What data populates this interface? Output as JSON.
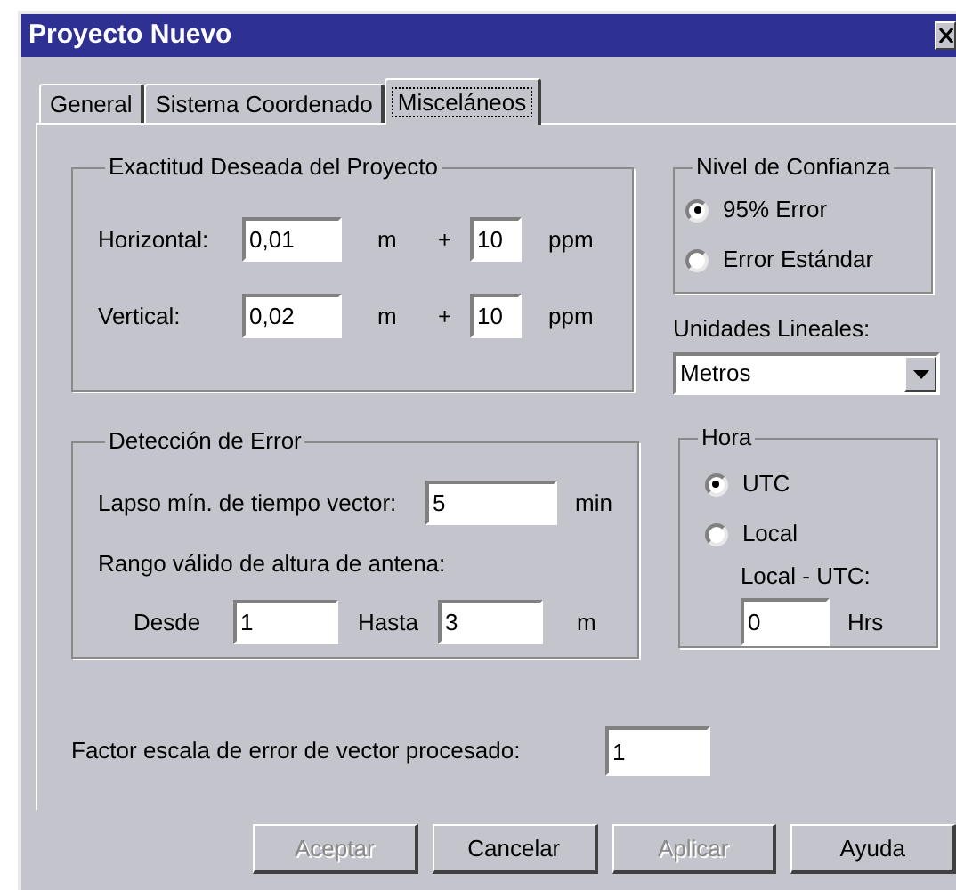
{
  "window": {
    "title": "Proyecto Nuevo"
  },
  "tabs": [
    {
      "label": "General",
      "selected": false
    },
    {
      "label": "Sistema Coordenado",
      "selected": false
    },
    {
      "label": "Misceláneos",
      "selected": true
    }
  ],
  "accuracy": {
    "title": "Exactitud Deseada del Proyecto",
    "rows": [
      {
        "label": "Horizontal:",
        "value": "0,01",
        "unit": "m",
        "plus": "+",
        "ppm_value": "10",
        "ppm_unit": "ppm"
      },
      {
        "label": "Vertical:",
        "value": "0,02",
        "unit": "m",
        "plus": "+",
        "ppm_value": "10",
        "ppm_unit": "ppm"
      }
    ]
  },
  "confidence": {
    "title": "Nivel de Confianza",
    "options": [
      {
        "label": "95% Error",
        "selected": true
      },
      {
        "label": "Error Estándar",
        "selected": false
      }
    ]
  },
  "units": {
    "label": "Unidades Lineales:",
    "value": "Metros"
  },
  "error_detection": {
    "title": "Detección de Error",
    "min_time": {
      "label": "Lapso mín. de tiempo vector:",
      "value": "5",
      "unit": "min"
    },
    "range_label": "Rango válido de altura de antena:",
    "from": {
      "label": "Desde",
      "value": "1"
    },
    "to": {
      "label": "Hasta",
      "value": "3",
      "unit": "m"
    }
  },
  "time": {
    "title": "Hora",
    "options": [
      {
        "label": "UTC",
        "selected": true
      },
      {
        "label": "Local",
        "selected": false
      }
    ],
    "offset": {
      "label": "Local - UTC:",
      "value": "0",
      "unit": "Hrs"
    }
  },
  "scale": {
    "label": "Factor escala de error de vector procesado:",
    "value": "1"
  },
  "buttons": [
    {
      "label": "Aceptar",
      "disabled": true
    },
    {
      "label": "Cancelar",
      "disabled": false
    },
    {
      "label": "Aplicar",
      "disabled": true
    },
    {
      "label": "Ayuda",
      "disabled": false
    }
  ]
}
